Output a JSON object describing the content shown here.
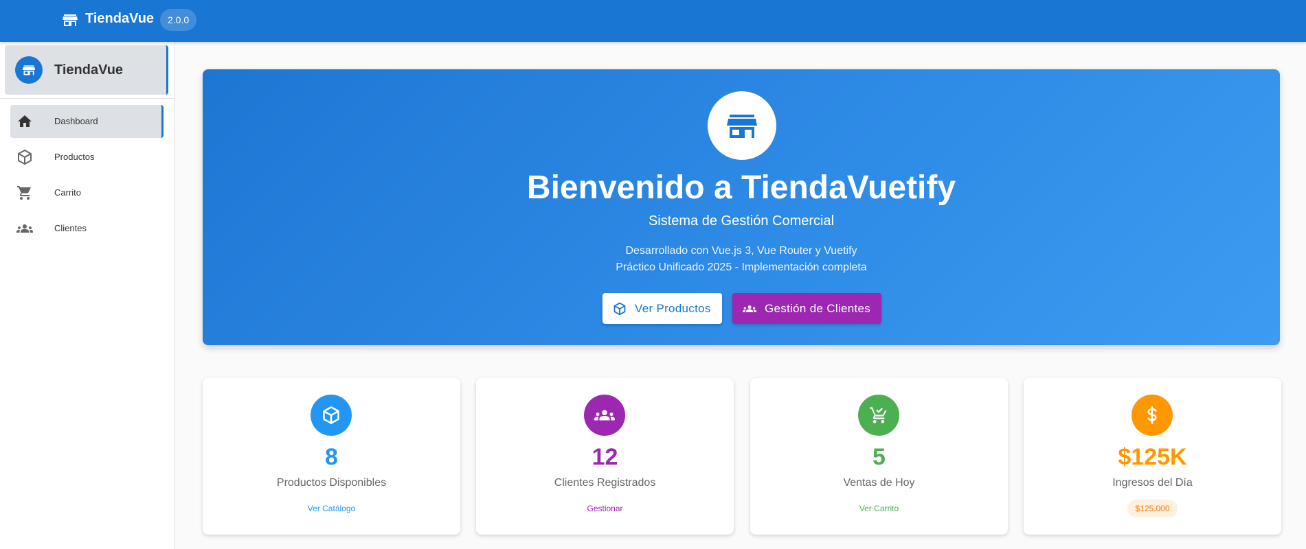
{
  "app": {
    "brand_title": "TiendaVue",
    "version": "2.0.0",
    "primary_color": "#1976d2"
  },
  "sidebar": {
    "header_title": "TiendaVue",
    "items": [
      {
        "label": "Dashboard",
        "icon": "home-icon",
        "active": true
      },
      {
        "label": "Productos",
        "icon": "package-icon",
        "active": false
      },
      {
        "label": "Carrito",
        "icon": "cart-icon",
        "active": false
      },
      {
        "label": "Clientes",
        "icon": "users-icon",
        "active": false
      }
    ]
  },
  "hero": {
    "icon": "store-icon",
    "title": "Bienvenido a TiendaVuetify",
    "subtitle": "Sistema de Gestión Comercial",
    "description_line1": "Desarrollado con Vue.js 3, Vue Router y Vuetify",
    "description_line2": "Práctico Unificado 2025 - Implementación completa",
    "buttons": {
      "products_label": "Ver Productos",
      "clients_label": "Gestión de Clientes"
    }
  },
  "stats": [
    {
      "icon": "package-icon",
      "value": "8",
      "label": "Productos Disponibles",
      "action": "Ver Catálogo",
      "color": "#2196f3"
    },
    {
      "icon": "users-icon",
      "value": "12",
      "label": "Clientes Registrados",
      "action": "Gestionar",
      "color": "#9c27b0"
    },
    {
      "icon": "cart-check-icon",
      "value": "5",
      "label": "Ventas de Hoy",
      "action": "Ver Carrito",
      "color": "#4caf50"
    },
    {
      "icon": "dollar-icon",
      "value": "$125K",
      "label": "Ingresos del Día",
      "chip": "$125.000",
      "color": "#ff9800"
    }
  ]
}
